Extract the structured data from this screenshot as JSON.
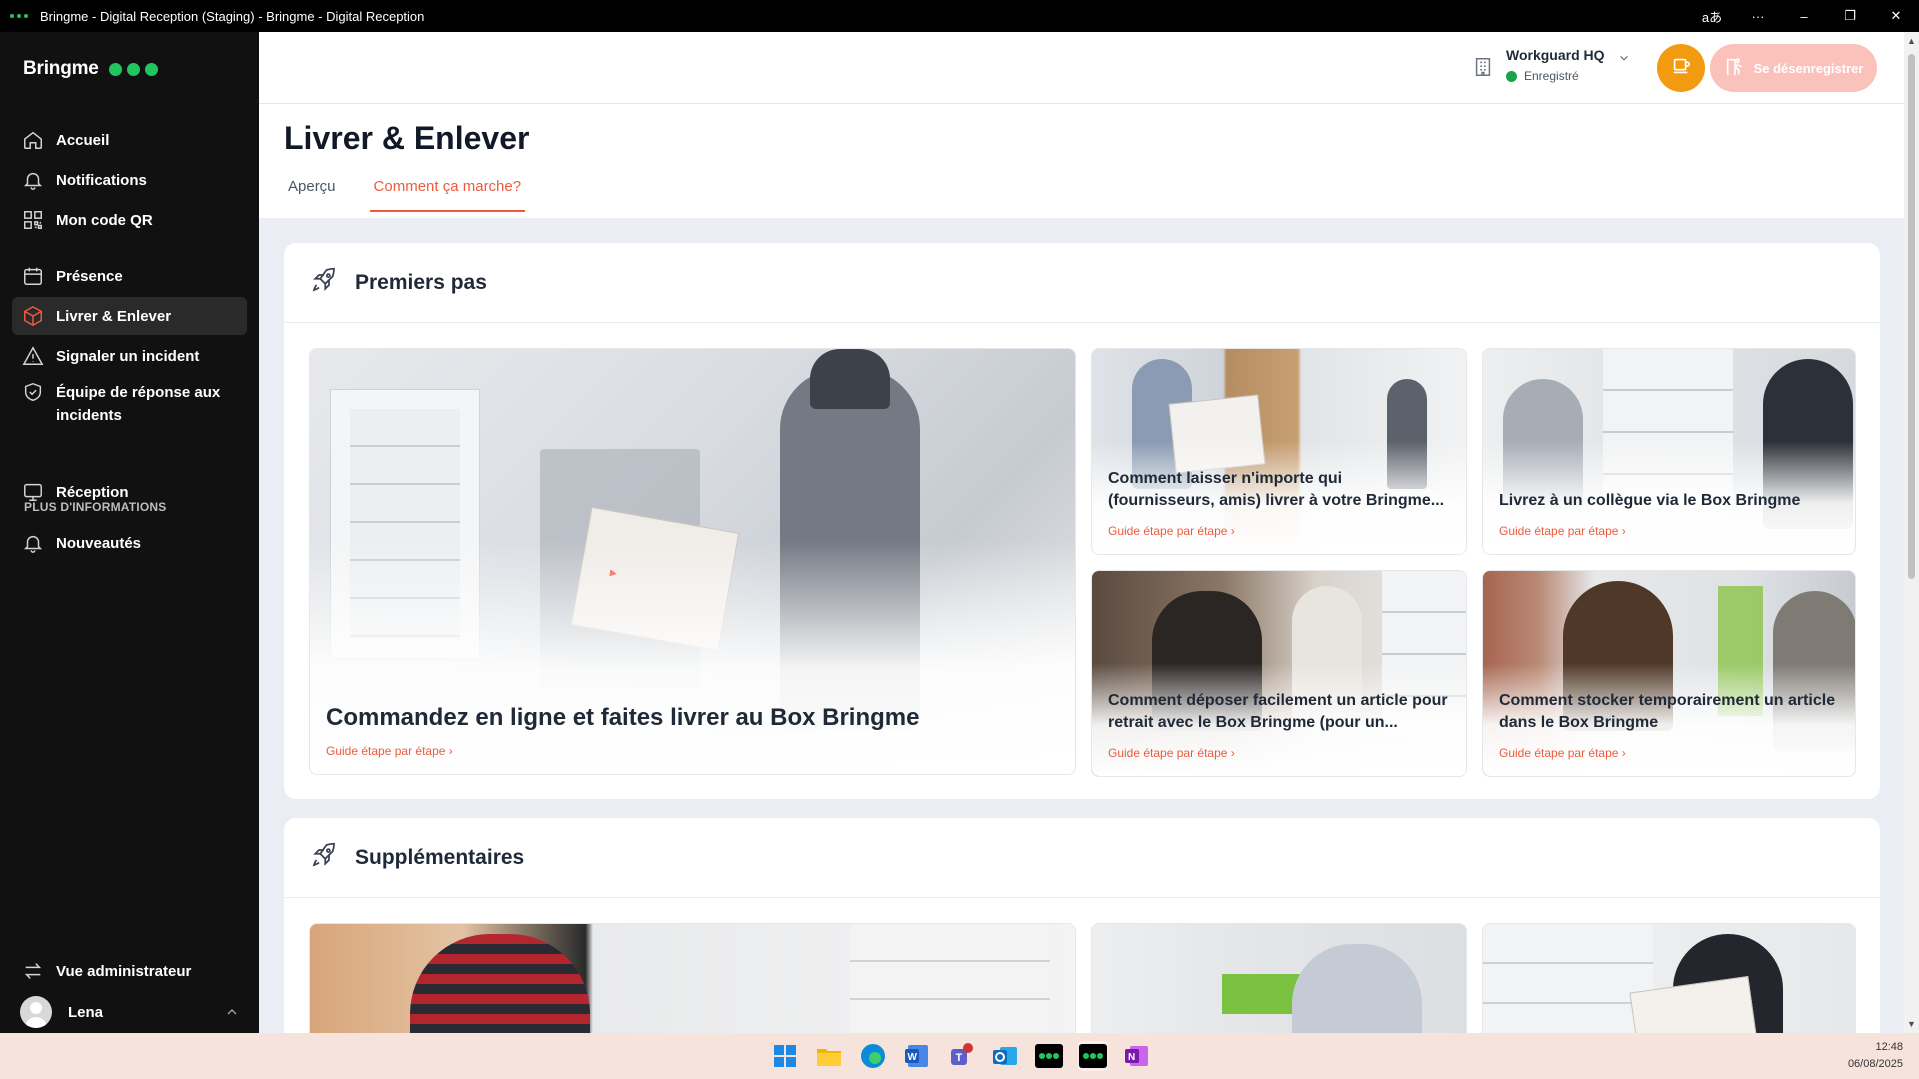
{
  "window": {
    "title": "Bringme - Digital Reception (Staging) - Bringme - Digital Reception",
    "controls": [
      "aあ",
      "···",
      "–",
      "❐",
      "✕"
    ]
  },
  "sidebar": {
    "brand": "Bringme",
    "items": [
      {
        "label": "Accueil",
        "icon": "home-icon"
      },
      {
        "label": "Notifications",
        "icon": "bell-icon"
      },
      {
        "label": "Mon code QR",
        "icon": "qr-code-icon"
      },
      {
        "label": "Présence",
        "icon": "calendar-icon"
      },
      {
        "label": "Livrer & Enlever",
        "icon": "package-icon",
        "active": true
      },
      {
        "label": "Signaler un incident",
        "icon": "warning-icon"
      },
      {
        "label": "Équipe de réponse aux incidents",
        "icon": "shield-check-icon"
      },
      {
        "label": "Réception",
        "icon": "monitor-icon"
      }
    ],
    "section_label": "PLUS D'INFORMATIONS",
    "extra_items": [
      {
        "label": "Nouveautés",
        "icon": "bell-icon"
      }
    ],
    "admin_label": "Vue administrateur",
    "user_name": "Lena"
  },
  "header": {
    "location_name": "Workguard HQ",
    "location_status": "Enregistré",
    "checkout_label": "Se désenregistrer"
  },
  "page": {
    "title": "Livrer & Enlever",
    "tabs": [
      {
        "label": "Aperçu",
        "active": false
      },
      {
        "label": "Comment ça marche?",
        "active": true
      }
    ]
  },
  "sections": [
    {
      "title": "Premiers pas",
      "cards": [
        {
          "title": "Commandez en ligne et faites livrer au Box Bringme",
          "link": "Guide étape par étape"
        },
        {
          "title": "Comment laisser n'importe qui (fournisseurs, amis) livrer à votre Bringme...",
          "link": "Guide étape par étape"
        },
        {
          "title": "Livrez à un collègue via le Box Bringme",
          "link": "Guide étape par étape"
        },
        {
          "title": "Comment déposer facilement un article pour retrait avec le Box Bringme (pour un...",
          "link": "Guide étape par étape"
        },
        {
          "title": "Comment stocker temporairement un article dans le Box Bringme",
          "link": "Guide étape par étape"
        }
      ]
    },
    {
      "title": "Supplémentaires",
      "cards": []
    }
  ],
  "taskbar": {
    "time": "12:48",
    "date": "06/08/2025"
  },
  "colors": {
    "accent": "#ef5a3e",
    "brand_green": "#22c55e",
    "sidebar_bg": "#111111",
    "coffee": "#f29b10",
    "checkout": "#fbc1bb"
  }
}
